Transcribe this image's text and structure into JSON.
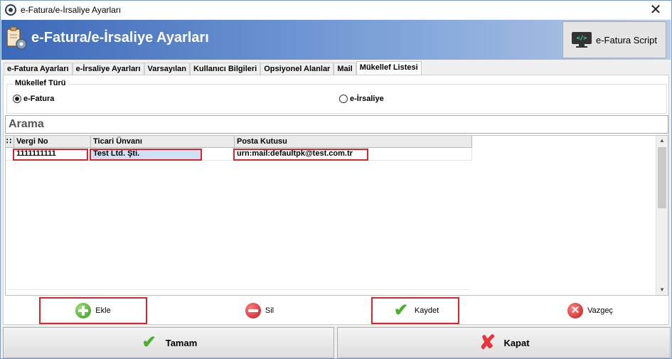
{
  "window": {
    "title": "e-Fatura/e-İrsaliye Ayarları",
    "close_glyph": "✕"
  },
  "header": {
    "title": "e-Fatura/e-İrsaliye Ayarları",
    "script_button": "e-Fatura Script",
    "script_icon_glyph": "</>"
  },
  "tabs": [
    {
      "label": "e-Fatura Ayarları"
    },
    {
      "label": "e-İrsaliye Ayarları"
    },
    {
      "label": "Varsayılan"
    },
    {
      "label": "Kullanıcı Bilgileri"
    },
    {
      "label": "Opsiyonel Alanlar"
    },
    {
      "label": "Mail"
    },
    {
      "label": "Mükellef Listesi",
      "active": true
    }
  ],
  "taxpayer_type": {
    "legend": "Mükellef Türü",
    "options": [
      {
        "label": "e-Fatura",
        "selected": true
      },
      {
        "label": "e-İrsaliye",
        "selected": false
      }
    ]
  },
  "search": {
    "label": "Arama"
  },
  "grid": {
    "indicator": "∷",
    "columns": [
      "Vergi No",
      "Ticari Ünvanı",
      "Posta Kutusu"
    ],
    "rows": [
      {
        "vergi_no": "1111111111",
        "ticari_unvan": "Test Ltd. Şti.",
        "posta_kutusu": "urn:mail:defaultpk@test.com.tr"
      }
    ]
  },
  "actions": {
    "add": "Ekle",
    "delete": "Sil",
    "save": "Kaydet",
    "cancel": "Vazgeç"
  },
  "footer": {
    "ok": "Tamam",
    "close": "Kapat"
  },
  "colors": {
    "header_start": "#3b68b8",
    "highlight": "#d9252b",
    "accent_green": "#48b02a",
    "accent_red": "#e8343a"
  },
  "icons": [
    "app-icon",
    "settings-icon",
    "monitor-code-icon",
    "plus-icon",
    "minus-icon",
    "check-icon",
    "x-icon"
  ]
}
